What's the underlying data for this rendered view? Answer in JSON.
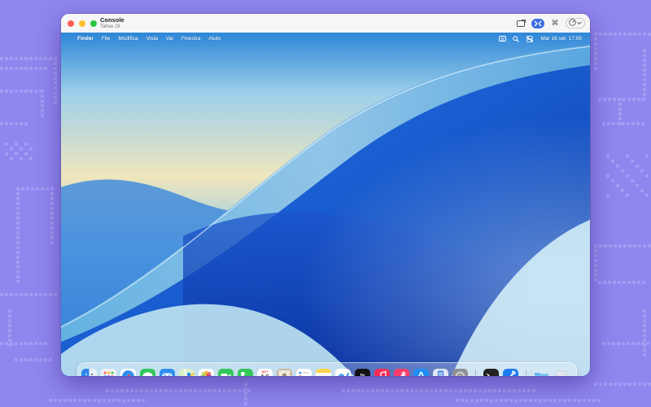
{
  "window": {
    "title": "Console",
    "subtitle": "Tahoe 26"
  },
  "menubar": {
    "app": "Finder",
    "items": [
      "File",
      "Modifica",
      "Vista",
      "Vai",
      "Finestra",
      "Aiuto"
    ],
    "clock": "Mar 16 set  17:05"
  },
  "dock": {
    "apps": [
      {
        "name": "Finder",
        "icon": "finder-icon",
        "running": true
      },
      {
        "name": "Launchpad",
        "icon": "launchpad-icon",
        "running": false
      },
      {
        "name": "Safari",
        "icon": "safari-icon",
        "running": true
      },
      {
        "name": "Messaggi",
        "icon": "messages-icon",
        "running": false
      },
      {
        "name": "Mail",
        "icon": "mail-icon",
        "running": false
      },
      {
        "name": "Mappe",
        "icon": "maps-icon",
        "running": false
      },
      {
        "name": "Foto",
        "icon": "photos-icon",
        "running": false
      },
      {
        "name": "FaceTime",
        "icon": "facetime-icon",
        "running": false
      },
      {
        "name": "Telefono",
        "icon": "phone-icon",
        "running": false
      },
      {
        "name": "Calendario",
        "icon": "calendar-icon",
        "running": false
      },
      {
        "name": "Contatti",
        "icon": "contacts-icon",
        "running": false
      },
      {
        "name": "Promemoria",
        "icon": "reminders-icon",
        "running": false
      },
      {
        "name": "Note",
        "icon": "notes-icon",
        "running": false
      },
      {
        "name": "Freeform",
        "icon": "freeform-icon",
        "running": false
      },
      {
        "name": "TV",
        "icon": "tv-icon",
        "running": false
      },
      {
        "name": "Musica",
        "icon": "music-icon",
        "running": false
      },
      {
        "name": "Games",
        "icon": "games-icon",
        "running": false
      },
      {
        "name": "App Store",
        "icon": "appstore-icon",
        "running": false
      },
      {
        "name": "iPhone Mirroring",
        "icon": "iphone-mirroring-icon",
        "running": false
      },
      {
        "name": "Impostazioni di Sistema",
        "icon": "system-settings-icon",
        "running": false
      },
      {
        "name": "Terminale",
        "icon": "terminal-icon",
        "running": false
      },
      {
        "name": "Xcode",
        "icon": "xcode-icon",
        "running": false
      },
      {
        "name": "Download",
        "icon": "downloads-folder-icon",
        "running": false
      },
      {
        "name": "Cestino",
        "icon": "trash-icon",
        "running": false
      }
    ],
    "calendar_day": "16",
    "calendar_month": "SET",
    "tv_label": "tv"
  },
  "colors": {
    "background": "#8f86ee",
    "pattern": "#a39cf4",
    "accent": "#3b6ee0"
  }
}
